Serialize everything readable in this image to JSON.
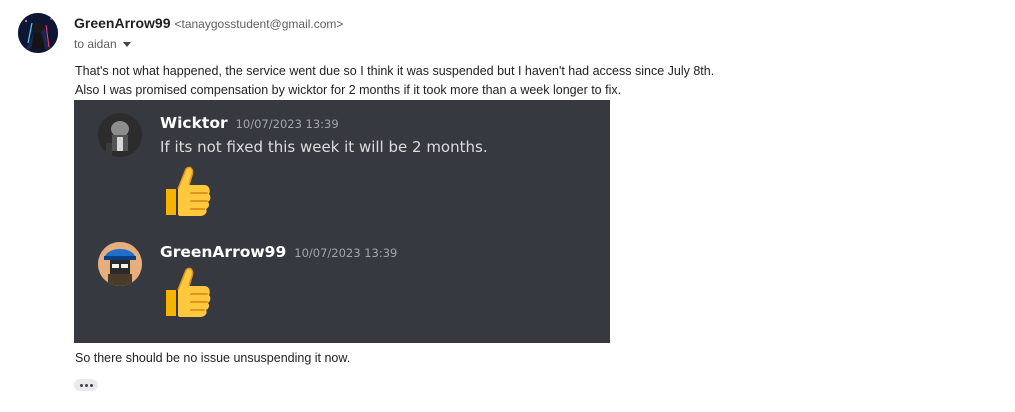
{
  "email": {
    "sender_name": "GreenArrow99",
    "sender_email": "<tanaygosstudent@gmail.com>",
    "to_label": "to aidan",
    "body_line1": "That's not what happened, the service went due so I think it was suspended but I haven't had access since July 8th.",
    "body_line2": "Also I was promised compensation by wicktor for 2 months if it took more than a week longer to fix.",
    "body_line3": "So there should be no issue unsuspending it now."
  },
  "attachment": {
    "messages": [
      {
        "author": "Wicktor",
        "timestamp": "10/07/2023 13:39",
        "text": "If its not fixed this week it will be 2 months.",
        "emoji": "thumbs-up"
      },
      {
        "author": "GreenArrow99",
        "timestamp": "10/07/2023 13:39",
        "text": "",
        "emoji": "thumbs-up"
      }
    ],
    "background_color": "#36393f"
  },
  "icons": {
    "caret": "chevron-down-icon",
    "more": "more-horizontal-icon"
  }
}
